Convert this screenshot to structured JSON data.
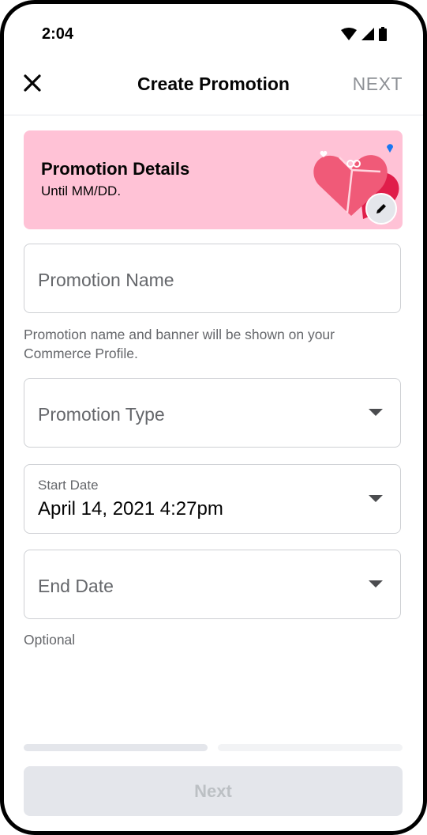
{
  "status": {
    "time": "2:04"
  },
  "header": {
    "title": "Create Promotion",
    "next_label": "NEXT"
  },
  "banner": {
    "title": "Promotion Details",
    "subtitle": "Until MM/DD."
  },
  "fields": {
    "promotion_name": {
      "placeholder": "Promotion Name"
    },
    "promotion_name_helper": "Promotion name and banner will be shown on your Commerce Profile.",
    "promotion_type": {
      "placeholder": "Promotion Type"
    },
    "start_date": {
      "label": "Start Date",
      "value": "April 14, 2021 4:27pm"
    },
    "end_date": {
      "placeholder": "End Date"
    },
    "end_date_helper": "Optional"
  },
  "progress": {
    "current_step": 1,
    "total_steps": 2
  },
  "footer": {
    "next_label": "Next"
  },
  "colors": {
    "banner_bg": "#ffc2d6",
    "button_disabled_bg": "#e4e6eb",
    "button_disabled_text": "#bcc0c4",
    "header_next_disabled": "#8e9196"
  }
}
